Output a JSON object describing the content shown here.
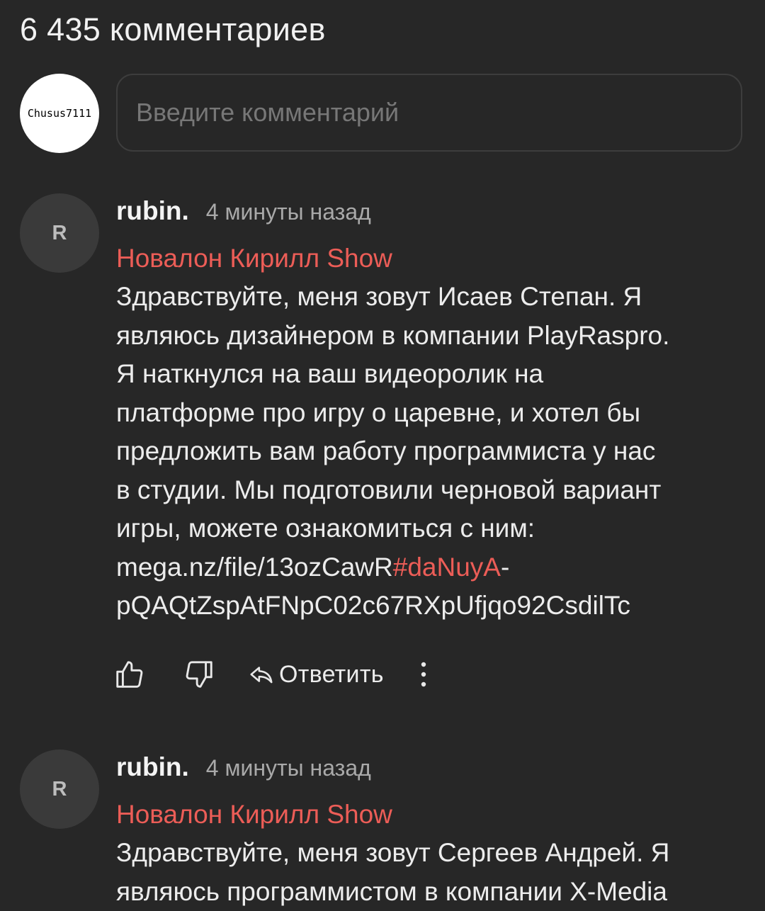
{
  "header": {
    "comment_count": "6 435 комментариев"
  },
  "compose": {
    "avatar_text": "Chusus7111",
    "placeholder": "Введите комментарий"
  },
  "comments": [
    {
      "avatar_letter": "R",
      "author": "rubin.",
      "time": "4 минуты назад",
      "channel": "Новалон Кирилл Show",
      "lines": [
        "Здравствуйте, меня зовут Исаев Степан. Я",
        "являюсь дизайнером в компании PlayRaspro.",
        "Я наткнулся на ваш видеоролик на",
        "платформе про игру о царевне, и хотел бы",
        "предложить вам работу программиста у нас",
        "в студии. Мы подготовили черновой вариант",
        "игры, можете ознакомиться с ним:"
      ],
      "link": {
        "prefix": "mega.nz/file/13ozCawR",
        "hashtag": "#daNuyA",
        "suffix": "-",
        "line2": "pQAQtZspAtFNpC02c67RXpUfjqo92CsdilTc"
      },
      "actions": {
        "like_icon": "thumbs-up-icon",
        "dislike_icon": "thumbs-down-icon",
        "reply_icon": "reply-arrow-icon",
        "reply_label": "Ответить",
        "more_icon": "more-vertical-icon"
      }
    },
    {
      "avatar_letter": "R",
      "author": "rubin.",
      "time": "4 минуты назад",
      "channel": "Новалон Кирилл Show",
      "lines": [
        "Здравствуйте, меня зовут Сергеев Андрей. Я",
        "являюсь программистом в компании X-Media"
      ]
    }
  ],
  "colors": {
    "background": "#272727",
    "accent": "#ec5d57",
    "avatar": "#3a3a3a"
  }
}
